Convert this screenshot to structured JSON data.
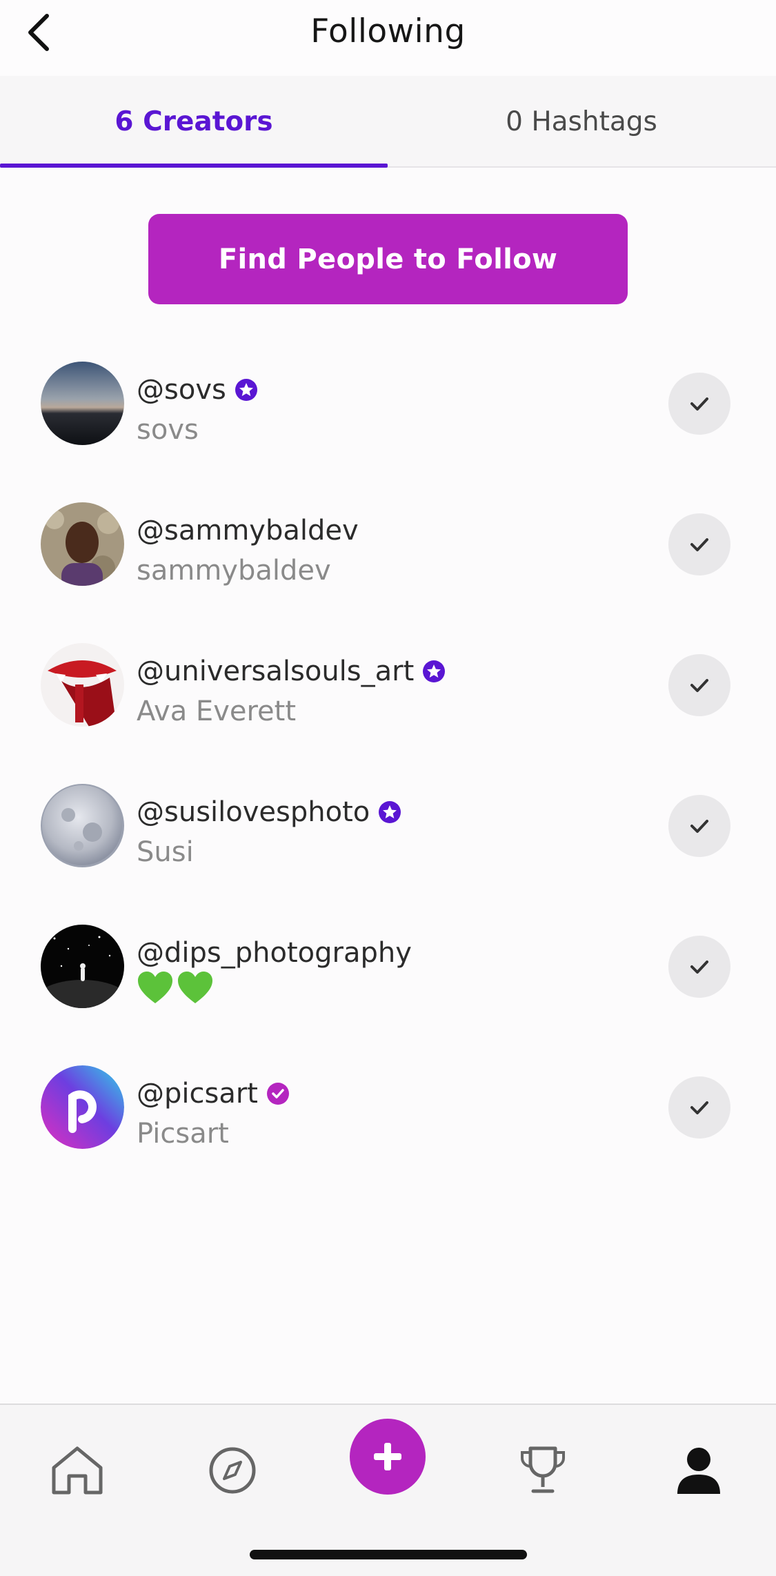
{
  "header": {
    "title": "Following"
  },
  "tabs": [
    {
      "label": "6 Creators",
      "active": true
    },
    {
      "label": "0 Hashtags",
      "active": false
    }
  ],
  "find_button": {
    "label": "Find People to Follow"
  },
  "creators": [
    {
      "handle": "@sovs",
      "name": "sovs",
      "badge": "star-badge"
    },
    {
      "handle": "@sammybaldev",
      "name": "sammybaldev",
      "badge": ""
    },
    {
      "handle": "@universalsouls_art",
      "name": "Ava Everett",
      "badge": "star-badge"
    },
    {
      "handle": "@susilovesphoto",
      "name": "Susi",
      "badge": "star-badge"
    },
    {
      "handle": "@dips_photography",
      "name": "💚💚",
      "badge": ""
    },
    {
      "handle": "@picsart",
      "name": "Picsart",
      "badge": "verified-check-badge"
    }
  ],
  "bottom_nav": [
    "home-icon",
    "explore-compass-icon",
    "create-plus-icon",
    "challenges-trophy-icon",
    "profile-icon"
  ],
  "colors": {
    "accent": "#5a16d3",
    "brand": "#b425bf"
  }
}
